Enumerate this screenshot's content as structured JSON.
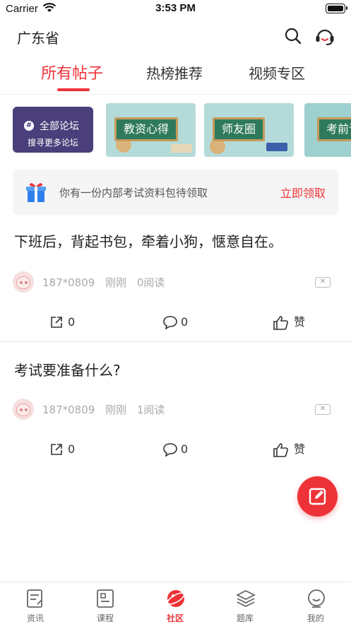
{
  "status_bar": {
    "carrier": "Carrier",
    "time": "3:53 PM"
  },
  "header": {
    "province": "广东省",
    "icons": [
      "search-icon",
      "customer-service-icon"
    ]
  },
  "tabs": [
    {
      "label": "所有帖子",
      "active": true
    },
    {
      "label": "热榜推荐",
      "active": false
    },
    {
      "label": "视频专区",
      "active": false
    }
  ],
  "forums": {
    "all": {
      "icon": "#",
      "title": "全部论坛",
      "subtitle": "搜寻更多论坛"
    },
    "cards": [
      {
        "label": "教资心得"
      },
      {
        "label": "师友圈"
      },
      {
        "label": "考前诉"
      }
    ]
  },
  "promo": {
    "text": "你有一份内部考试资料包待领取",
    "action": "立即领取"
  },
  "posts": [
    {
      "title": "下班后，背起书包，牵着小狗，惬意自在。",
      "user": "187*0809",
      "time": "刚刚",
      "reads": "0阅读",
      "shares": "0",
      "comments": "0",
      "like_label": "赞"
    },
    {
      "title": "考试要准备什么?",
      "user": "187*0809",
      "time": "刚刚",
      "reads": "1阅读",
      "shares": "0",
      "comments": "0",
      "like_label": "赞"
    }
  ],
  "bottom_nav": [
    {
      "label": "资讯",
      "icon": "news-icon",
      "active": false
    },
    {
      "label": "课程",
      "icon": "course-icon",
      "active": false
    },
    {
      "label": "社区",
      "icon": "community-icon",
      "active": true
    },
    {
      "label": "题库",
      "icon": "question-bank-icon",
      "active": false
    },
    {
      "label": "我的",
      "icon": "profile-icon",
      "active": false
    }
  ],
  "colors": {
    "accent": "#ee3338",
    "forum_all_bg": "#4a3f7a",
    "text": "#222222",
    "muted": "#aaaaaa"
  }
}
